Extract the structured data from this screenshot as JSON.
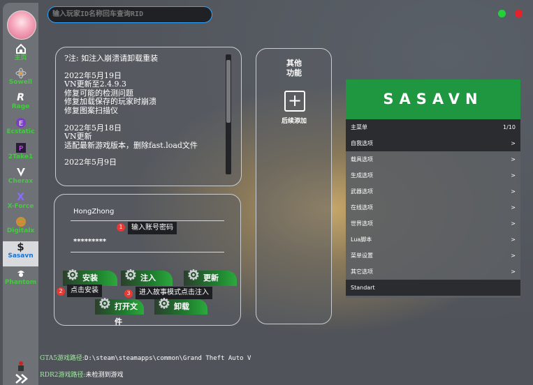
{
  "search": {
    "placeholder": "输入玩家ID名称回车查询RID"
  },
  "window": {
    "dot_green": "#23d13b",
    "dot_red": "#e8202a"
  },
  "sidebar": {
    "items": [
      {
        "label": "主页",
        "icon": "home-icon"
      },
      {
        "label": "Sowell",
        "icon": "atom-icon"
      },
      {
        "label": "Rage",
        "icon": "r-logo-icon"
      },
      {
        "label": "Ecstatic",
        "icon": "e-logo-icon"
      },
      {
        "label": "2Take1",
        "icon": "p-logo-icon"
      },
      {
        "label": "Cherax",
        "icon": "v-logo-icon"
      },
      {
        "label": "X-Force",
        "icon": "x-logo-icon"
      },
      {
        "label": "Digitalx",
        "icon": "globe-icon"
      },
      {
        "label": "Sasavn",
        "icon": "dollar-icon"
      },
      {
        "label": "Phantom",
        "icon": "pirate-icon"
      }
    ],
    "active_index": 8
  },
  "notes": {
    "paragraphs": [
      "?注: 如注入崩溃请卸载重装",
      "2022年5月19日\nVN更新至2.4.9.3\n修复可能的检测问题\n修复加载保存的玩家时崩溃\n修复图案扫描仪",
      "2022年5月18日\nVN更新\n适配最新游戏版本，删除fast.load文件",
      "2022年5月9日"
    ]
  },
  "login": {
    "username": "HongZhong",
    "password": "*********",
    "hint_account": "输入账号密码",
    "hint_install": "点击安装",
    "hint_story": "进入故事模式点击注入",
    "badge_1": "1",
    "badge_2": "2",
    "badge_3": "3"
  },
  "buttons": {
    "install": "安装",
    "inject": "注入",
    "update": "更新",
    "open_file": "打开文件",
    "uninstall": "卸载"
  },
  "other": {
    "title": "其他\n功能",
    "add_label": "后续添加"
  },
  "menu": {
    "brand": "SASAVN",
    "header_label": "主菜单",
    "page": "1/10",
    "items": [
      {
        "label": "自我选项",
        "arrow": ">"
      },
      {
        "label": "载具选项",
        "arrow": ">"
      },
      {
        "label": "生成选项",
        "arrow": ">"
      },
      {
        "label": "武器选项",
        "arrow": ">"
      },
      {
        "label": "在线选项",
        "arrow": ">"
      },
      {
        "label": "世界选项",
        "arrow": ">"
      },
      {
        "label": "Lua脚本",
        "arrow": ">"
      },
      {
        "label": "菜单设置",
        "arrow": ">"
      },
      {
        "label": "其它选项",
        "arrow": ">"
      },
      {
        "label": "Standart",
        "arrow": ""
      }
    ]
  },
  "paths": {
    "gta5_label": "GTA5游戏路径:",
    "gta5_value": "D:\\steam\\steamapps\\common\\Grand Theft Auto V",
    "rdr2_label": "RDR2游戏路径:",
    "rdr2_value": "未检测到游戏"
  }
}
